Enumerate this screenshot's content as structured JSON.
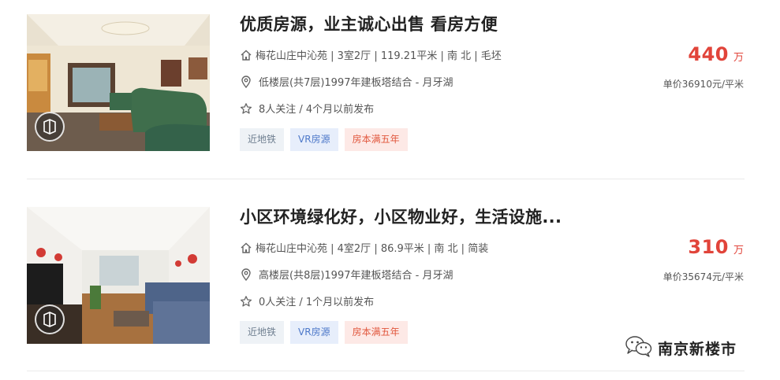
{
  "listings": [
    {
      "title": "优质房源，业主诚心出售 看房方便",
      "house_info": "梅花山庄中沁苑 | 3室2厅 | 119.21平米 | 南 北 | 毛坯",
      "floor_info": "低楼层(共7层)1997年建板塔结合 - 月牙湖",
      "follow_info": "8人关注 / 4个月以前发布",
      "tags": [
        "近地铁",
        "VR房源",
        "房本满五年"
      ],
      "total_price": "440",
      "price_unit": "万",
      "unit_price": "单价36910元/平米",
      "icons": {
        "house": "house-icon",
        "location": "location-pin-icon",
        "follow": "star-icon",
        "vr": "vr-icon"
      }
    },
    {
      "title": "小区环境绿化好，小区物业好，生活设施...",
      "house_info": "梅花山庄中沁苑 | 4室2厅 | 86.9平米 | 南 北 | 简装",
      "floor_info": "高楼层(共8层)1997年建板塔结合 - 月牙湖",
      "follow_info": "0人关注 / 1个月以前发布",
      "tags": [
        "近地铁",
        "VR房源",
        "房本满五年"
      ],
      "total_price": "310",
      "price_unit": "万",
      "unit_price": "单价35674元/平米",
      "icons": {
        "house": "house-icon",
        "location": "location-pin-icon",
        "follow": "star-icon",
        "vr": "vr-icon"
      }
    }
  ],
  "watermark": {
    "text": "南京新楼市",
    "icon": "wechat-icon"
  },
  "colors": {
    "price": "#e1443a",
    "tag_metro_bg": "#eef2f6",
    "tag_vr_bg": "#e7eefb",
    "tag_five_bg": "#fde9e6"
  }
}
